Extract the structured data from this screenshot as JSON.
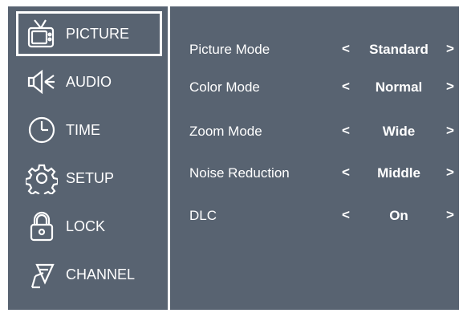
{
  "sidebar": {
    "items": [
      {
        "label": "PICTURE",
        "icon": "tv-icon",
        "selected": true
      },
      {
        "label": "AUDIO",
        "icon": "speaker-icon",
        "selected": false
      },
      {
        "label": "TIME",
        "icon": "clock-icon",
        "selected": false
      },
      {
        "label": "SETUP",
        "icon": "gear-icon",
        "selected": false
      },
      {
        "label": "LOCK",
        "icon": "lock-icon",
        "selected": false
      },
      {
        "label": "CHANNEL",
        "icon": "satellite-dish-icon",
        "selected": false
      }
    ]
  },
  "settings": {
    "rows": [
      {
        "label": "Picture Mode",
        "value": "Standard"
      },
      {
        "label": "Color Mode",
        "value": "Normal"
      },
      {
        "label": "Zoom Mode",
        "value": "Wide"
      },
      {
        "label": "Noise Reduction",
        "value": "Middle"
      },
      {
        "label": "DLC",
        "value": "On"
      }
    ],
    "left_arrow": "<",
    "right_arrow": ">"
  },
  "colors": {
    "background": "#586371",
    "text": "#ffffff",
    "border": "#ffffff"
  }
}
